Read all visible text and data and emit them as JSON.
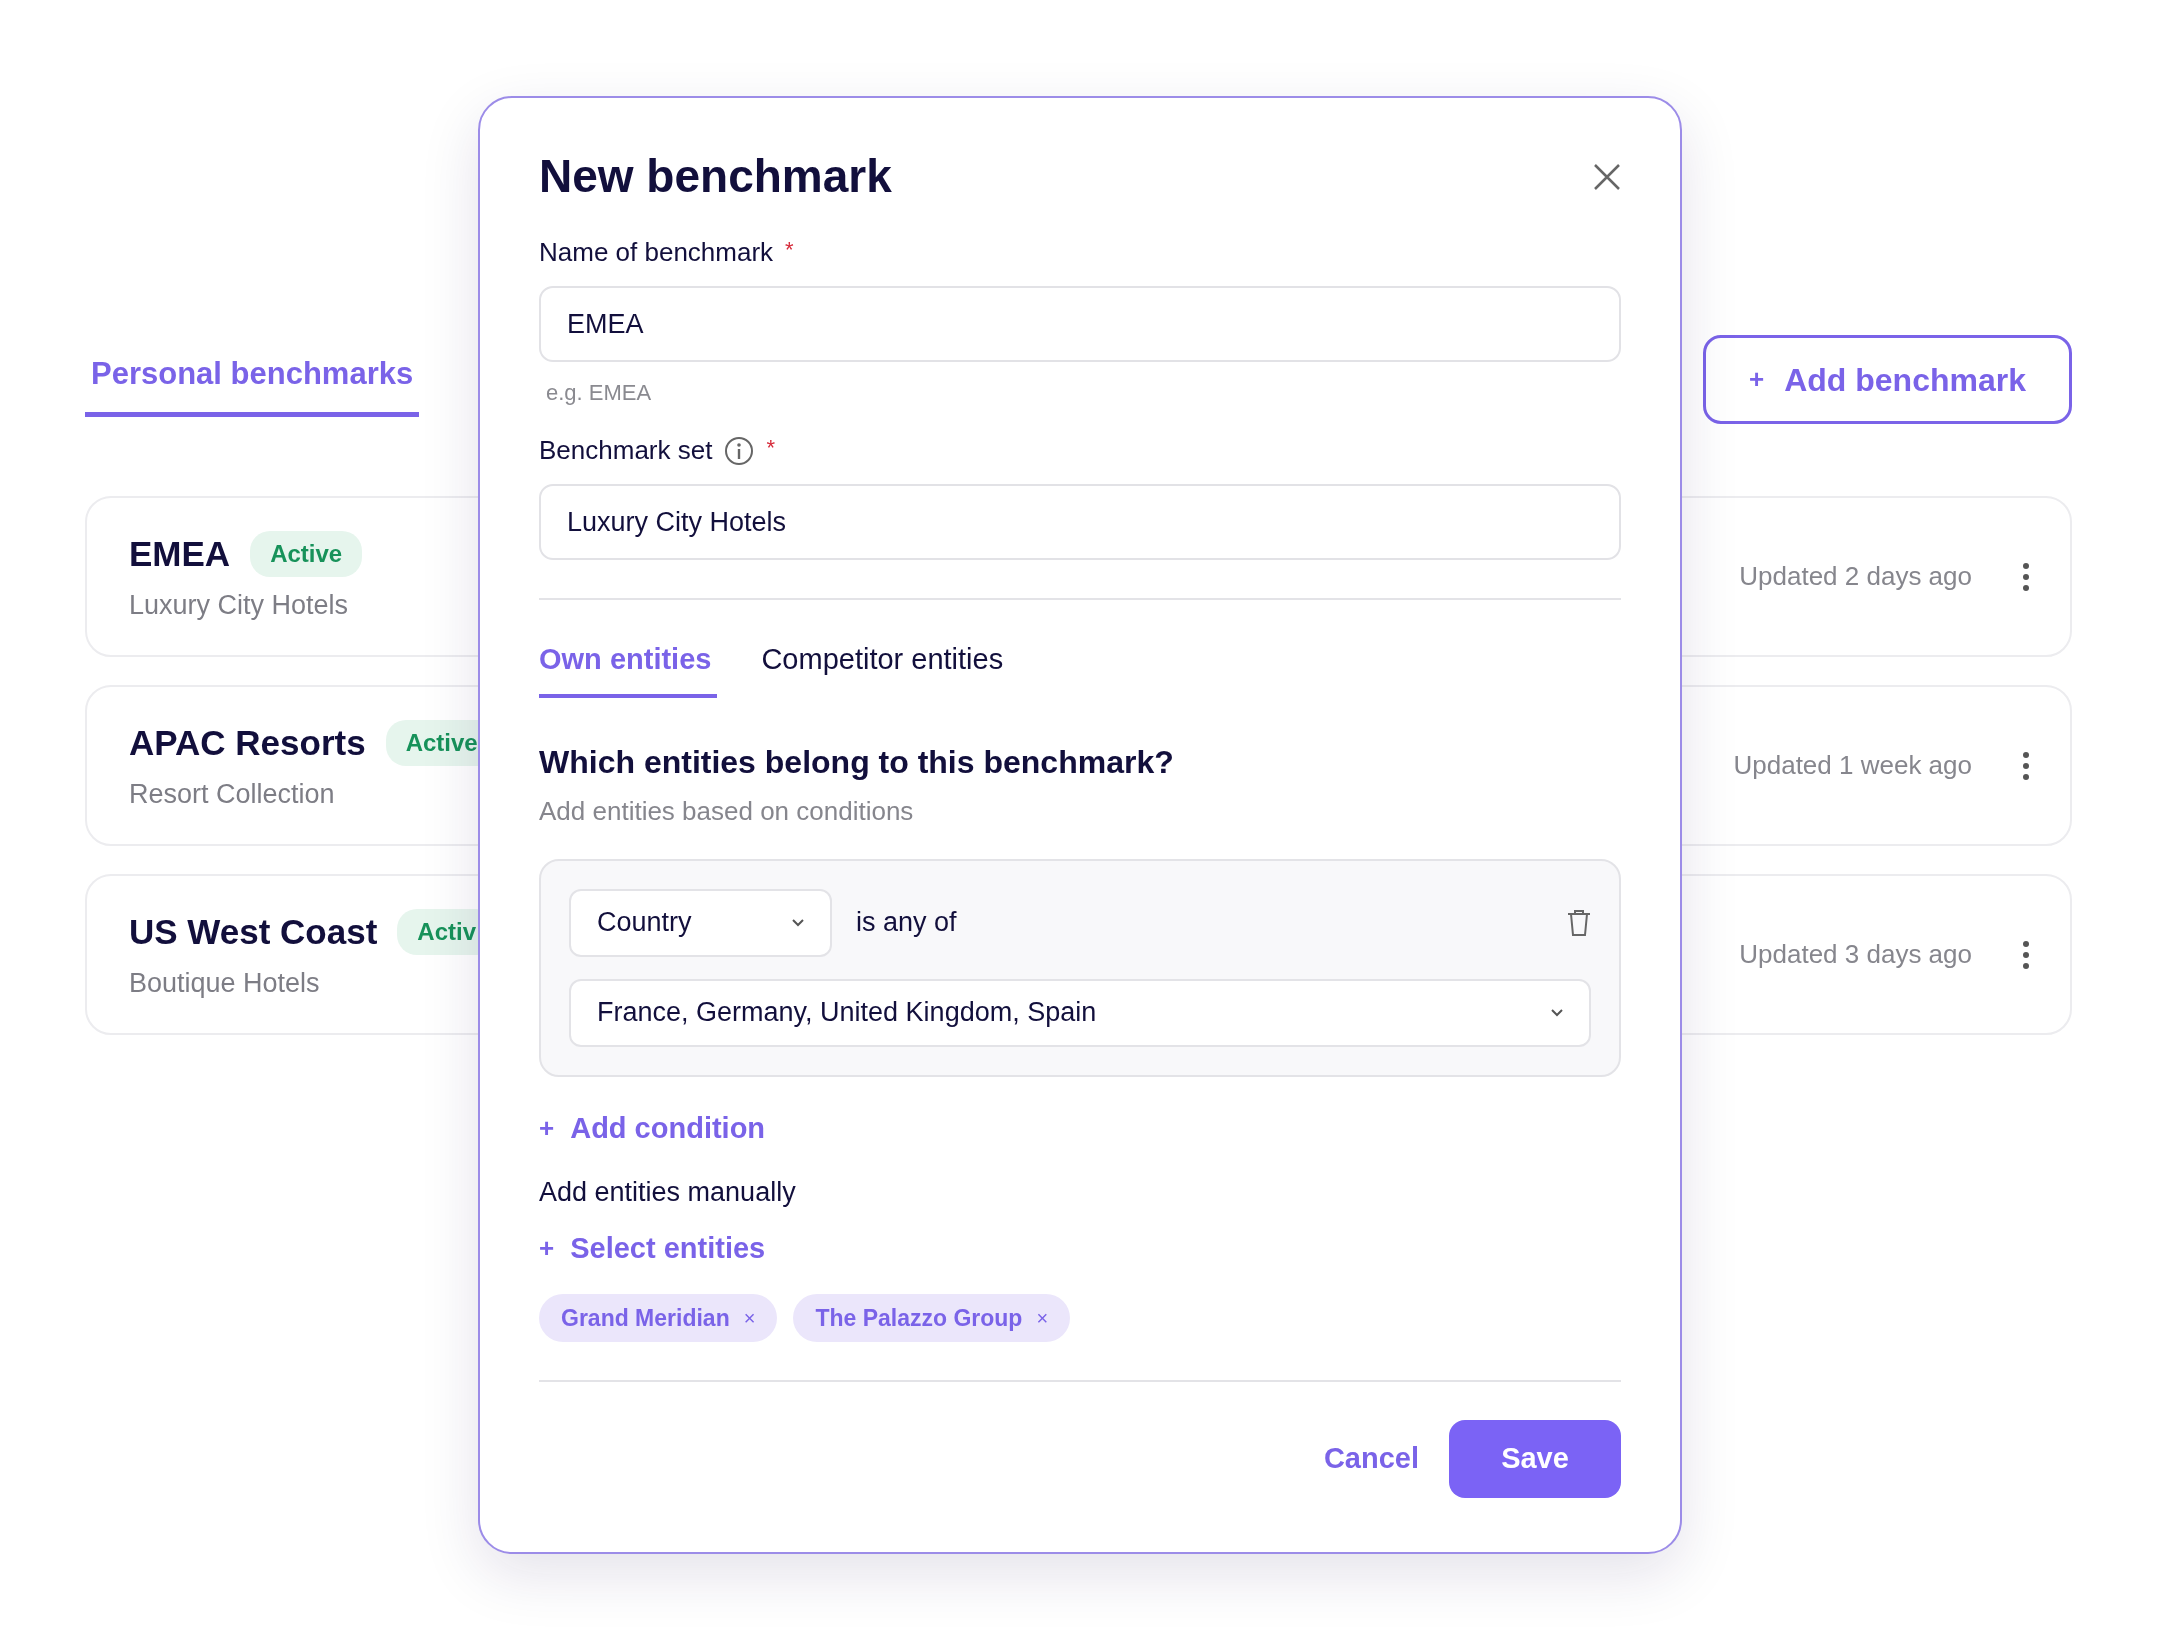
{
  "page_tab": {
    "label": "Personal benchmarks",
    "selected": true
  },
  "add_button": {
    "icon": "+",
    "label": "Add benchmark"
  },
  "benchmarks": [
    {
      "name": "EMEA",
      "status": "Active",
      "set": "Luxury City Hotels",
      "updated": "Updated 2 days ago"
    },
    {
      "name": "APAC Resorts",
      "status": "Active",
      "set": "Resort Collection",
      "updated": "Updated 1 week ago"
    },
    {
      "name": "US West Coast",
      "status": "Activ",
      "set": "Boutique Hotels",
      "updated": "Updated 3 days ago"
    }
  ],
  "modal": {
    "title": "New benchmark",
    "fields": [
      {
        "label": "Name of benchmark",
        "info": false,
        "required_mark": "*",
        "value": "EMEA",
        "hint": "e.g. EMEA"
      },
      {
        "label": "Benchmark set",
        "info": true,
        "required_mark": "*",
        "value": "Luxury City Hotels"
      }
    ],
    "tabs": [
      {
        "label": "Own entities",
        "selected": true
      },
      {
        "label": "Competitor entities",
        "selected": false
      }
    ],
    "section_title": "Which entities belong to this benchmark?",
    "section_subtitle": "Add entities based on conditions",
    "condition": {
      "field": "Country",
      "operator": "is any of",
      "values": "France, Germany, United Kingdom, Spain"
    },
    "add_condition": {
      "icon": "+",
      "label": "Add condition"
    },
    "manual_label": "Add entities manually",
    "select_entities": {
      "icon": "+",
      "label": "Select entities"
    },
    "chips": [
      {
        "label": "Grand Meridian",
        "remove": "×"
      },
      {
        "label": "The Palazzo Group",
        "remove": "×"
      }
    ],
    "buttons": [
      {
        "kind": "secondary",
        "label": "Cancel"
      },
      {
        "kind": "primary",
        "label": "Save"
      }
    ]
  }
}
